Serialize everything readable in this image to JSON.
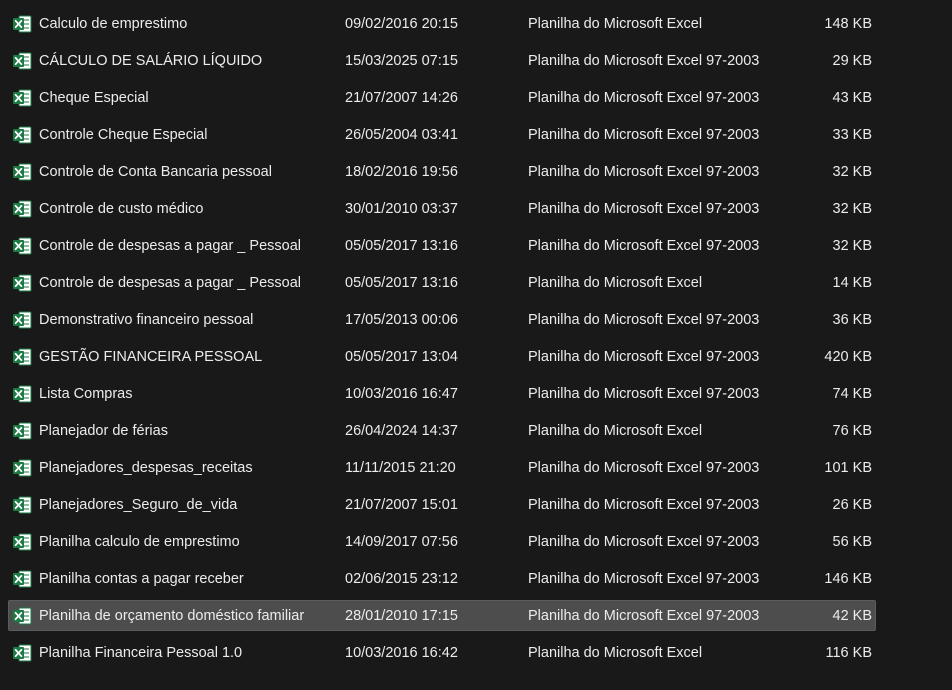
{
  "files": [
    {
      "name": "Calculo de emprestimo",
      "date": "09/02/2016 20:15",
      "type": "Planilha do Microsoft Excel",
      "size": "148 KB",
      "icon": "excel-file-icon"
    },
    {
      "name": "CÁLCULO DE SALÁRIO LÍQUIDO",
      "date": "15/03/2025 07:15",
      "type": "Planilha do Microsoft Excel 97-2003",
      "size": "29 KB",
      "icon": "excel-file-icon"
    },
    {
      "name": "Cheque Especial",
      "date": "21/07/2007 14:26",
      "type": "Planilha do Microsoft Excel 97-2003",
      "size": "43 KB",
      "icon": "excel-file-icon"
    },
    {
      "name": "Controle Cheque Especial",
      "date": "26/05/2004 03:41",
      "type": "Planilha do Microsoft Excel 97-2003",
      "size": "33 KB",
      "icon": "excel-file-icon"
    },
    {
      "name": "Controle de Conta Bancaria pessoal",
      "date": "18/02/2016 19:56",
      "type": "Planilha do Microsoft Excel 97-2003",
      "size": "32 KB",
      "icon": "excel-file-icon"
    },
    {
      "name": "Controle de custo médico",
      "date": "30/01/2010 03:37",
      "type": "Planilha do Microsoft Excel 97-2003",
      "size": "32 KB",
      "icon": "excel-file-icon"
    },
    {
      "name": "Controle de despesas a pagar _ Pessoal",
      "date": "05/05/2017 13:16",
      "type": "Planilha do Microsoft Excel 97-2003",
      "size": "32 KB",
      "icon": "excel-file-icon"
    },
    {
      "name": "Controle de despesas a pagar _ Pessoal",
      "date": "05/05/2017 13:16",
      "type": "Planilha do Microsoft Excel",
      "size": "14 KB",
      "icon": "excel-file-icon"
    },
    {
      "name": "Demonstrativo financeiro pessoal",
      "date": "17/05/2013 00:06",
      "type": "Planilha do Microsoft Excel 97-2003",
      "size": "36 KB",
      "icon": "excel-file-icon"
    },
    {
      "name": "GESTÃO FINANCEIRA PESSOAL",
      "date": "05/05/2017 13:04",
      "type": "Planilha do Microsoft Excel 97-2003",
      "size": "420 KB",
      "icon": "excel-file-icon"
    },
    {
      "name": "Lista Compras",
      "date": "10/03/2016 16:47",
      "type": "Planilha do Microsoft Excel 97-2003",
      "size": "74 KB",
      "icon": "excel-file-icon"
    },
    {
      "name": "Planejador de férias",
      "date": "26/04/2024 14:37",
      "type": "Planilha do Microsoft Excel",
      "size": "76 KB",
      "icon": "excel-file-icon"
    },
    {
      "name": "Planejadores_despesas_receitas",
      "date": "11/11/2015 21:20",
      "type": "Planilha do Microsoft Excel 97-2003",
      "size": "101 KB",
      "icon": "excel-file-icon"
    },
    {
      "name": "Planejadores_Seguro_de_vida",
      "date": "21/07/2007 15:01",
      "type": "Planilha do Microsoft Excel 97-2003",
      "size": "26 KB",
      "icon": "excel-file-icon"
    },
    {
      "name": "Planilha calculo de emprestimo",
      "date": "14/09/2017 07:56",
      "type": "Planilha do Microsoft Excel 97-2003",
      "size": "56 KB",
      "icon": "excel-file-icon"
    },
    {
      "name": "Planilha contas a pagar receber",
      "date": "02/06/2015 23:12",
      "type": "Planilha do Microsoft Excel 97-2003",
      "size": "146 KB",
      "icon": "excel-file-icon"
    },
    {
      "name": "Planilha de orçamento doméstico familiar",
      "date": "28/01/2010 17:15",
      "type": "Planilha do Microsoft Excel 97-2003",
      "size": "42 KB",
      "icon": "excel-file-icon",
      "selected": true
    },
    {
      "name": "Planilha Financeira Pessoal 1.0",
      "date": "10/03/2016 16:42",
      "type": "Planilha do Microsoft Excel",
      "size": "116 KB",
      "icon": "excel-file-icon"
    }
  ],
  "colors": {
    "background": "#191919",
    "text": "#ececec",
    "selection": "#4d4d4d",
    "excel_green": "#1d7a45",
    "excel_green_dark": "#0f5c30"
  }
}
